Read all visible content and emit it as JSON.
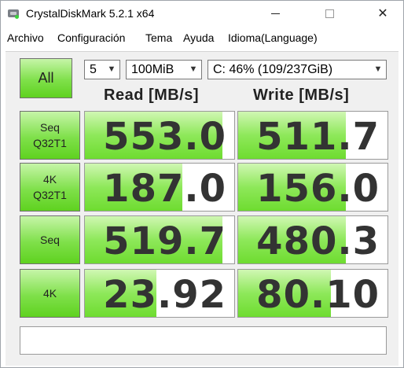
{
  "window": {
    "title": "CrystalDiskMark 5.2.1 x64",
    "controls": {
      "minimize": "",
      "maximize": "",
      "close": "✕"
    }
  },
  "menu": [
    "Archivo",
    "Configuración",
    "Tema",
    "Ayuda",
    "Idioma(Language)"
  ],
  "controls": {
    "all_label": "All",
    "count": "5",
    "size": "100MiB",
    "drive": "C: 46% (109/237GiB)"
  },
  "headers": {
    "read": "Read [MB/s]",
    "write": "Write [MB/s]"
  },
  "rows": [
    {
      "label_line1": "Seq",
      "label_line2": "Q32T1",
      "read": "553.0",
      "write": "511.7",
      "read_fill": 0.92,
      "write_fill": 0.72
    },
    {
      "label_line1": "4K",
      "label_line2": "Q32T1",
      "read": "187.0",
      "write": "156.0",
      "read_fill": 0.65,
      "write_fill": 0.72
    },
    {
      "label_line1": "Seq",
      "label_line2": "",
      "read": "519.7",
      "write": "480.3",
      "read_fill": 0.92,
      "write_fill": 0.72
    },
    {
      "label_line1": "4K",
      "label_line2": "",
      "read": "23.92",
      "write": "80.10",
      "read_fill": 0.48,
      "write_fill": 0.62
    }
  ],
  "status": ""
}
